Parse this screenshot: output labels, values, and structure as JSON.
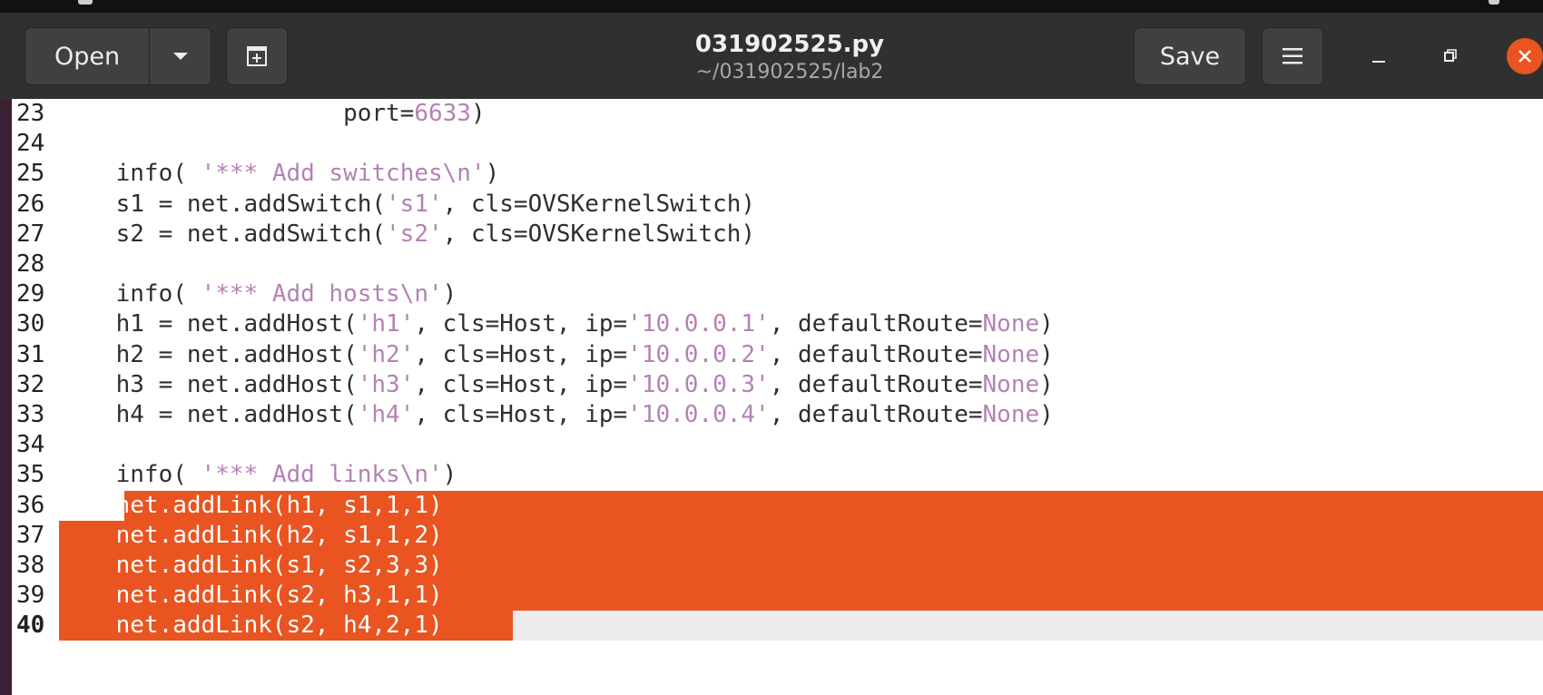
{
  "headerbar": {
    "open_label": "Open",
    "title": "031902525.py",
    "subtitle": "~/031902525/lab2",
    "save_label": "Save"
  },
  "colors": {
    "accent": "#e95420",
    "string": "#b482b4",
    "headerbar": "#303030"
  },
  "icons": {
    "open_menu": "chevron-down-icon",
    "new_tab": "new-document-icon",
    "menu": "hamburger-menu-icon",
    "minimize": "minimize-icon",
    "maximize": "maximize-icon",
    "close": "close-icon"
  },
  "editor": {
    "current_line": "40",
    "lines": [
      {
        "num": "23",
        "parts": [
          {
            "t": "                    port="
          },
          {
            "t": "6633",
            "s": true
          },
          {
            "t": ")"
          }
        ]
      },
      {
        "num": "24",
        "parts": [
          {
            "t": ""
          }
        ]
      },
      {
        "num": "25",
        "parts": [
          {
            "t": "    info( "
          },
          {
            "t": "'*** Add switches\\n'",
            "s": true
          },
          {
            "t": ")"
          }
        ]
      },
      {
        "num": "26",
        "parts": [
          {
            "t": "    s1 = net.addSwitch("
          },
          {
            "t": "'s1'",
            "s": true
          },
          {
            "t": ", cls=OVSKernelSwitch)"
          }
        ]
      },
      {
        "num": "27",
        "parts": [
          {
            "t": "    s2 = net.addSwitch("
          },
          {
            "t": "'s2'",
            "s": true
          },
          {
            "t": ", cls=OVSKernelSwitch)"
          }
        ]
      },
      {
        "num": "28",
        "parts": [
          {
            "t": ""
          }
        ]
      },
      {
        "num": "29",
        "parts": [
          {
            "t": "    info( "
          },
          {
            "t": "'*** Add hosts\\n'",
            "s": true
          },
          {
            "t": ")"
          }
        ]
      },
      {
        "num": "30",
        "parts": [
          {
            "t": "    h1 = net.addHost("
          },
          {
            "t": "'h1'",
            "s": true
          },
          {
            "t": ", cls=Host, ip="
          },
          {
            "t": "'10.0.0.1'",
            "s": true
          },
          {
            "t": ", defaultRoute="
          },
          {
            "t": "None",
            "s": true
          },
          {
            "t": ")"
          }
        ]
      },
      {
        "num": "31",
        "parts": [
          {
            "t": "    h2 = net.addHost("
          },
          {
            "t": "'h2'",
            "s": true
          },
          {
            "t": ", cls=Host, ip="
          },
          {
            "t": "'10.0.0.2'",
            "s": true
          },
          {
            "t": ", defaultRoute="
          },
          {
            "t": "None",
            "s": true
          },
          {
            "t": ")"
          }
        ]
      },
      {
        "num": "32",
        "parts": [
          {
            "t": "    h3 = net.addHost("
          },
          {
            "t": "'h3'",
            "s": true
          },
          {
            "t": ", cls=Host, ip="
          },
          {
            "t": "'10.0.0.3'",
            "s": true
          },
          {
            "t": ", defaultRoute="
          },
          {
            "t": "None",
            "s": true
          },
          {
            "t": ")"
          }
        ]
      },
      {
        "num": "33",
        "parts": [
          {
            "t": "    h4 = net.addHost("
          },
          {
            "t": "'h4'",
            "s": true
          },
          {
            "t": ", cls=Host, ip="
          },
          {
            "t": "'10.0.0.4'",
            "s": true
          },
          {
            "t": ", defaultRoute="
          },
          {
            "t": "None",
            "s": true
          },
          {
            "t": ")"
          }
        ]
      },
      {
        "num": "34",
        "parts": [
          {
            "t": ""
          }
        ]
      },
      {
        "num": "35",
        "parts": [
          {
            "t": "    info( "
          },
          {
            "t": "'*** Add links\\n'",
            "s": true
          },
          {
            "t": ")"
          }
        ]
      },
      {
        "num": "36",
        "parts": [
          {
            "t": "    net.addLink(h1, s1,1,1)"
          }
        ]
      },
      {
        "num": "37",
        "parts": [
          {
            "t": "    net.addLink(h2, s1,1,2)"
          }
        ]
      },
      {
        "num": "38",
        "parts": [
          {
            "t": "    net.addLink(s1, s2,3,3)"
          }
        ]
      },
      {
        "num": "39",
        "parts": [
          {
            "t": "    net.addLink(s2, h3,1,1)"
          }
        ]
      },
      {
        "num": "40",
        "parts": [
          {
            "t": "    net.addLink(s2, h4,2,1)"
          }
        ]
      }
    ]
  }
}
